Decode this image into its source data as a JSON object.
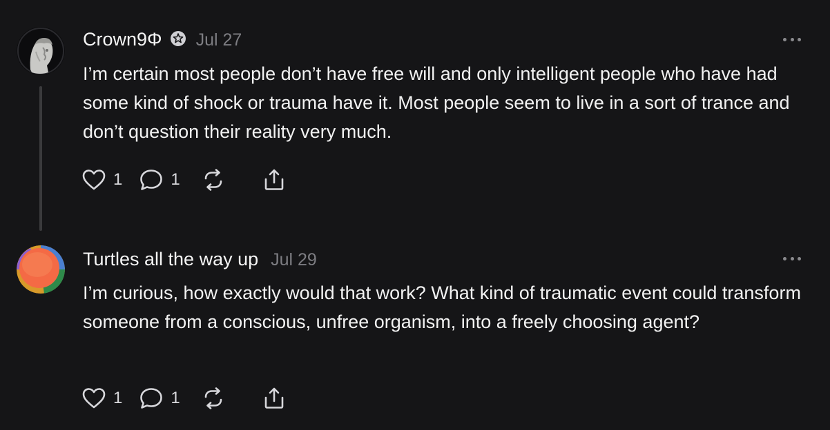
{
  "posts": [
    {
      "username": "Crown9Φ",
      "date": "Jul 27",
      "text": "I’m certain most people don’t have free will and only intelligent people who have had some kind of shock or trauma have it. Most people seem to live in a sort of trance and don’t question their reality very much.",
      "likes": "1",
      "replies": "1",
      "verified_icon": "badge-icon"
    },
    {
      "username": "Turtles all the way up",
      "date": "Jul 29",
      "text": "I’m curious, how exactly would that work? What kind of traumatic event could transform someone from a conscious, unfree organism, into a freely choosing agent?",
      "likes": "1",
      "replies": "1"
    }
  ],
  "colors": {
    "background": "#151517",
    "text": "#f2f2f2",
    "muted": "#7d7d82",
    "thread_line": "#3a3a3c"
  }
}
